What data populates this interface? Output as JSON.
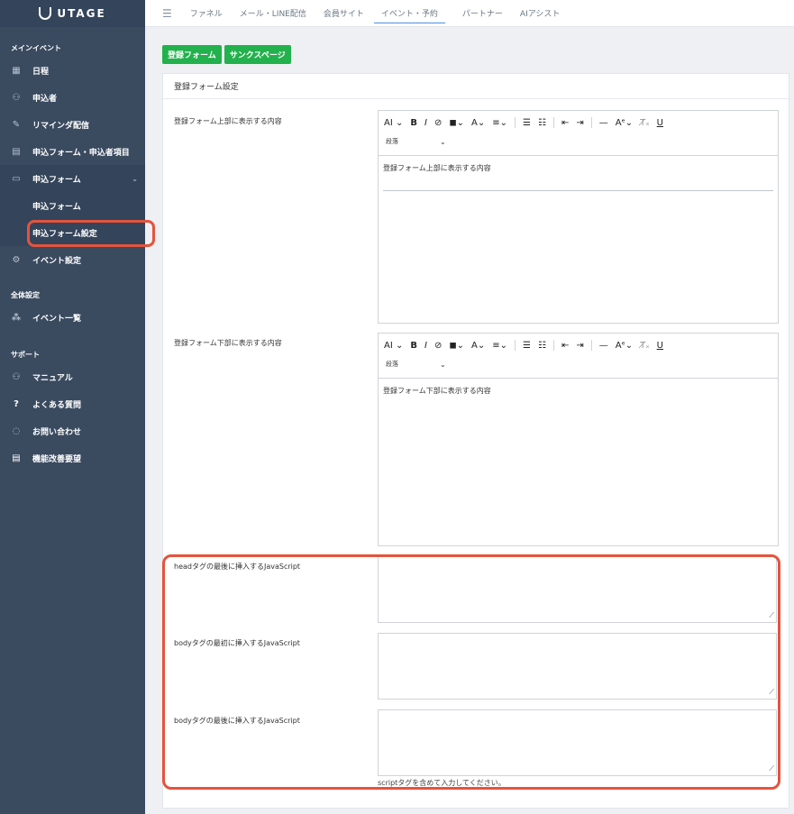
{
  "sidebar": {
    "logo": "UTAGE",
    "section_main": "メインイベント",
    "section_all": "全体設定",
    "section_support": "サポート",
    "items": {
      "schedule": "日程",
      "applicants": "申込者",
      "reminder": "リマインダ配信",
      "form_items": "申込フォーム・申込者項目",
      "forms": "申込フォーム",
      "form_sub": "申込フォーム",
      "form_settings": "申込フォーム設定",
      "event_settings": "イベント設定",
      "event_list": "イベント一覧",
      "manual": "マニュアル",
      "faq": "よくある質問",
      "contact": "お問い合わせ",
      "feature_request": "機能改善要望"
    }
  },
  "topnav": {
    "tabs": [
      "ファネル",
      "メール・LINE配信",
      "会員サイト",
      "イベント・予約",
      "パートナー",
      "AIアシスト"
    ],
    "active": "イベント・予約"
  },
  "buttons": {
    "register_form": "登録フォーム",
    "thanks_page": "サンクスページ"
  },
  "card": {
    "title": "登録フォーム設定",
    "upper_label": "登録フォーム上部に表示する内容",
    "upper_content": "登録フォーム上部に表示する内容",
    "lower_label": "登録フォーム下部に表示する内容",
    "lower_content": "登録フォーム下部に表示する内容",
    "paragraph": "段落",
    "head_js_label": "headタグの最後に挿入するJavaScript",
    "body_first_js_label": "bodyタグの最初に挿入するJavaScript",
    "body_last_js_label": "bodyタグの最後に挿入するJavaScript",
    "help": "scriptタグを含めて入力してください。"
  },
  "colors": {
    "sidebar_bg": "#3a4a5f",
    "button_green": "#22b14c",
    "highlight_red": "#e5533d",
    "active_tab_underline": "#4a90e2"
  }
}
